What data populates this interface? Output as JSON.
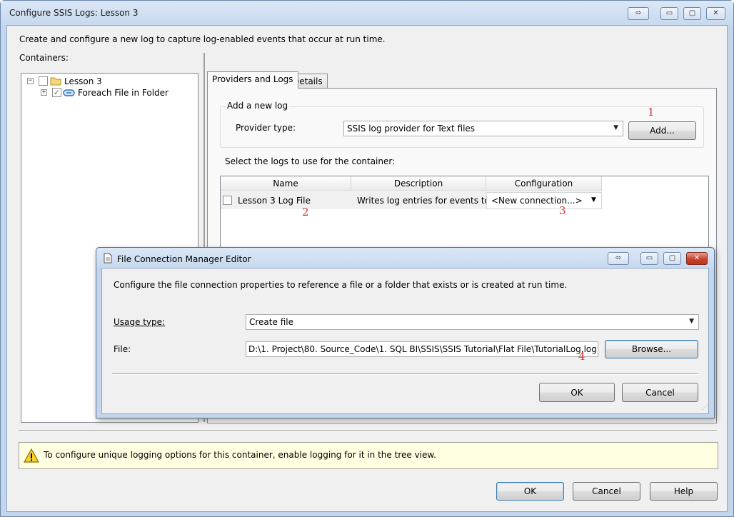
{
  "window": {
    "title": "Configure SSIS Logs: Lesson 3",
    "controls": {
      "restore": "⬄",
      "minimize": "▭",
      "maximize": "▢",
      "close": "✕"
    }
  },
  "description": "Create and configure a new log to capture log-enabled events that occur at run time.",
  "containers": {
    "label": "Containers:",
    "tree": [
      {
        "label": "Lesson 3",
        "expander": "−",
        "checked": false,
        "icon": "folder-icon"
      },
      {
        "label": "Foreach File in Folder",
        "expander": "+",
        "checked": true,
        "icon": "loop-container-icon"
      }
    ]
  },
  "tabs": [
    {
      "label": "Providers and Logs",
      "active": true
    },
    {
      "label": "Details",
      "active": false
    }
  ],
  "add_log": {
    "group_label": "Add a new log",
    "provider_label": "Provider type:",
    "provider_value": "SSIS log provider for Text files",
    "add_button": "Add..."
  },
  "logs": {
    "label": "Select the logs to use for the container:",
    "columns": [
      "Name",
      "Description",
      "Configuration"
    ],
    "rows": [
      {
        "checked": false,
        "name": "Lesson 3 Log File",
        "description": "Writes log entries for events to ...",
        "configuration": "<New connection...>"
      }
    ]
  },
  "annotations": [
    "1",
    "2",
    "3",
    "4"
  ],
  "info_message": "To configure unique logging options for this container, enable logging for it in the tree view.",
  "footer": {
    "ok": "OK",
    "cancel": "Cancel",
    "help": "Help"
  },
  "file_dialog": {
    "title": "File Connection Manager Editor",
    "description": "Configure the file connection properties to reference a file or a folder that exists or is created at run time.",
    "usage_label": "Usage type:",
    "usage_value": "Create file",
    "file_label": "File:",
    "file_value": "D:\\1. Project\\80. Source_Code\\1. SQL BI\\SSIS\\SSIS Tutorial\\Flat File\\TutorialLog.log",
    "browse_button": "Browse...",
    "ok_button": "OK",
    "cancel_button": "Cancel"
  },
  "colors": {
    "annotation": "#e03030",
    "info_background": "#ffffe1",
    "title_bar": "#c7d9ef"
  }
}
